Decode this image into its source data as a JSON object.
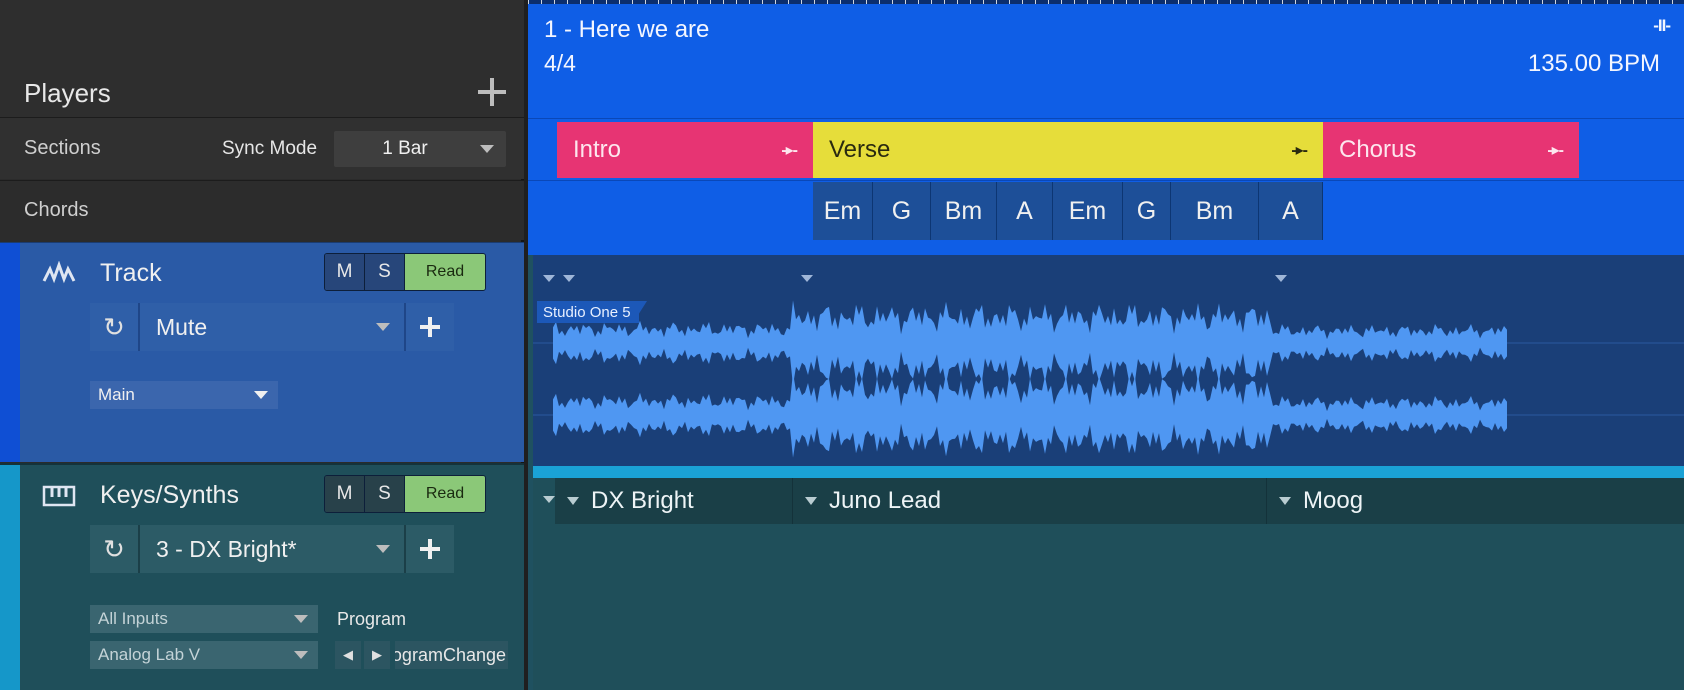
{
  "players_panel": {
    "title": "Players",
    "sections_label": "Sections",
    "sync_mode_label": "Sync Mode",
    "sync_mode_value": "1 Bar",
    "chords_label": "Chords"
  },
  "players": [
    {
      "name": "Track",
      "icon": "waveform-icon",
      "mute_label": "M",
      "solo_label": "S",
      "automation_label": "Read",
      "preset": "Mute",
      "output": "Main"
    },
    {
      "name": "Keys/Synths",
      "icon": "keyboard-icon",
      "mute_label": "M",
      "solo_label": "S",
      "automation_label": "Read",
      "preset": "3 - DX Bright*",
      "input": "All Inputs",
      "instrument": "Analog Lab V",
      "program_label": "Program",
      "program_value": "ProgramChange"
    }
  ],
  "song": {
    "title": "1 -  Here we are",
    "time_signature": "4/4",
    "tempo": "135.00 BPM",
    "end_marker": "-II-"
  },
  "sections": [
    {
      "name": "Intro",
      "color": "#e73473",
      "arrow": "-▸-"
    },
    {
      "name": "Verse",
      "color": "#e6dd3a",
      "arrow": "-▸-"
    },
    {
      "name": "Chorus",
      "color": "#e73473",
      "arrow": "-▸-"
    }
  ],
  "chords": [
    "Em",
    "G",
    "Bm",
    "A",
    "Em",
    "G",
    "Bm",
    "A"
  ],
  "audio_clip": {
    "name": "Studio One 5"
  },
  "instrument_changes": [
    "DX Bright",
    "Juno Lead",
    "Moog"
  ],
  "colors": {
    "track_accent": "#0f4fd4",
    "keys_accent": "#1597c9",
    "waveform": "#4f97f2",
    "read_button": "#8bc878"
  }
}
